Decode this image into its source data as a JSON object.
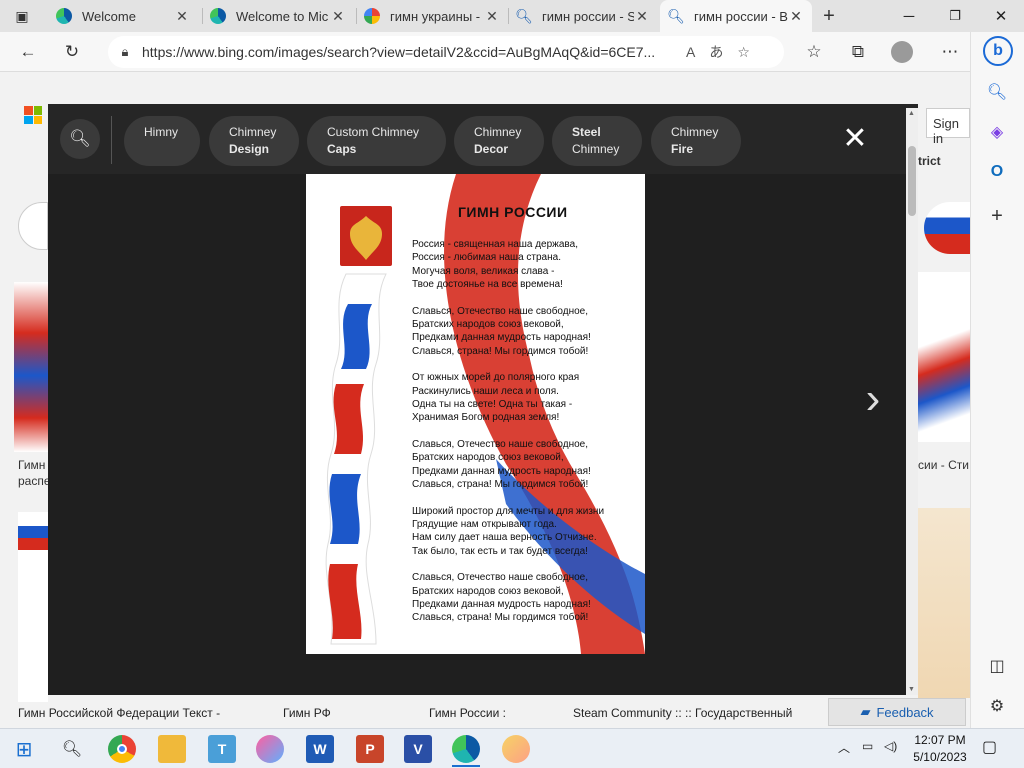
{
  "browser": {
    "tabs": [
      {
        "title": "Welcome",
        "favicon": "edge-icon",
        "active": false
      },
      {
        "title": "Welcome to Mic",
        "favicon": "edge-icon",
        "active": false
      },
      {
        "title": "гимн украины -",
        "favicon": "google-icon",
        "active": false
      },
      {
        "title": "гимн россии - S",
        "favicon": "search-icon",
        "active": false
      },
      {
        "title": "гимн россии - B",
        "favicon": "search-icon",
        "active": true
      }
    ],
    "new_tab": "+",
    "url": "https://www.bing.com/images/search?view=detailV2&ccid=AuBgMAqQ&id=6CE7..."
  },
  "background_page": {
    "sign_in": "Sign in",
    "district": "trict",
    "left_caption": [
      "Гимн",
      "распе"
    ],
    "right_caption": "сии - Сти",
    "bottom_results": [
      "Гимн Российской Федерации Текст -",
      "Гимн РФ",
      "Гимн России :",
      "Steam Community :: :: Государственный"
    ],
    "feedback": "Feedback"
  },
  "viewer": {
    "chips": [
      {
        "top": "Himny",
        "bottom": ""
      },
      {
        "top": "Chimney",
        "bottom": "Design"
      },
      {
        "top": "Custom Chimney",
        "bottom": "Caps"
      },
      {
        "top": "Chimney",
        "bottom": "Decor"
      },
      {
        "top": "Steel",
        "bottom": "Chimney"
      },
      {
        "top": "Chimney",
        "bottom": "Fire"
      }
    ],
    "close": "✕",
    "next": "›"
  },
  "anthem_image": {
    "title": "ГИМН РОССИИ",
    "verses": [
      [
        "Россия - священная наша держава,",
        "Россия - любимая наша страна.",
        "Могучая воля, великая слава -",
        "Твое достоянье на все времена!"
      ],
      [
        "Славься, Отечество наше свободное,",
        "Братских народов союз вековой,",
        "Предками данная мудрость народная!",
        "Славься, страна! Мы гордимся тобой!"
      ],
      [
        "От южных морей до полярного края",
        "Раскинулись наши леса и поля.",
        "Одна ты на свете! Одна ты такая -",
        "Хранимая Богом родная земля!"
      ],
      [
        "Славься, Отечество наше свободное,",
        "Братских народов союз вековой,",
        "Предками данная мудрость народная!",
        "Славься, страна! Мы гордимся тобой!"
      ],
      [
        "Широкий простор для мечты и для жизни",
        "Грядущие нам открывают года.",
        "Нам силу дает наша верность Отчизне.",
        "Так было, так есть и так будет всегда!"
      ],
      [
        "Славься, Отечество наше свободное,",
        "Братских народов союз вековой,",
        "Предками данная мудрость народная!",
        "Славься, страна! Мы гордимся тобой!"
      ]
    ]
  },
  "taskbar": {
    "apps": [
      "start-icon",
      "search-icon",
      "chrome-icon",
      "file-explorer-icon",
      "teams-icon",
      "paint3d-icon",
      "word-icon",
      "powerpoint-icon",
      "visio-icon",
      "edge-icon",
      "paint-icon"
    ],
    "time": "12:07 PM",
    "date": "5/10/2023"
  },
  "colors": {
    "accent": "#0c59a4",
    "overlay": "#1f1f1f",
    "chip": "#3a3a3a",
    "flag_red": "#d52b1e",
    "flag_blue": "#1c57c9"
  }
}
